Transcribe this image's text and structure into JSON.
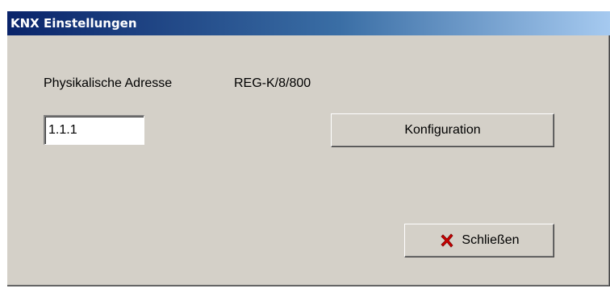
{
  "window": {
    "title": "KNX Einstellungen"
  },
  "form": {
    "address_label": "Physikalische Adresse",
    "device_label": "REG-K/8/800",
    "address_value": "1.1.1"
  },
  "buttons": {
    "configuration_label": "Konfiguration",
    "close_label": "Schließen",
    "close_icon": "close-icon",
    "close_icon_color": "#cc0000"
  }
}
